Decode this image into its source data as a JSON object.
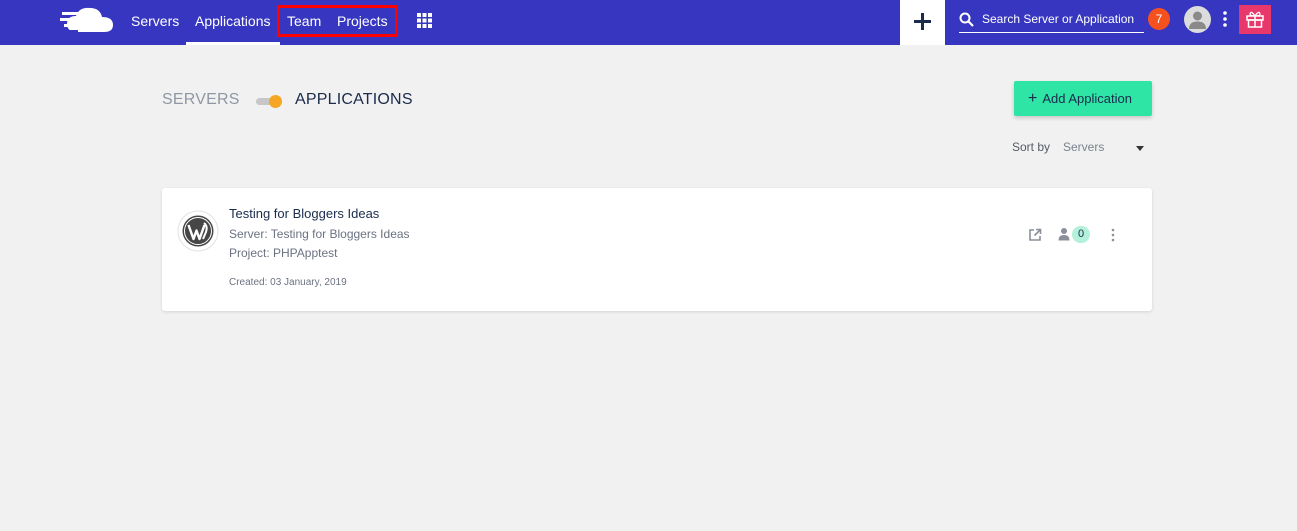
{
  "nav": {
    "logo": "cloudways-logo",
    "items": [
      {
        "label": "Servers"
      },
      {
        "label": "Applications"
      },
      {
        "label": "Team"
      },
      {
        "label": "Projects"
      }
    ],
    "active": "Applications"
  },
  "header": {
    "search_placeholder": "Search Server or Application",
    "notification_count": "7",
    "icons": [
      "grid-icon",
      "plus-icon",
      "search-icon",
      "avatar",
      "kebab-icon",
      "gift-icon"
    ]
  },
  "page": {
    "toggle_left_label": "SERVERS",
    "toggle_right_label": "APPLICATIONS",
    "toggle_state": "applications",
    "add_button_label": "Add Application",
    "sort_label": "Sort by",
    "sort_value": "Servers"
  },
  "applications": [
    {
      "name": "Testing for Bloggers Ideas",
      "server": "Server: Testing for Bloggers Ideas",
      "project": "Project: PHPApptest",
      "created": "Created: 03 January, 2019",
      "icon": "wordpress-icon",
      "members": "0"
    }
  ],
  "colors": {
    "topbar": "#3736c0",
    "accent": "#2ee5a5",
    "notification": "#f4511e",
    "gift": "#e8386b",
    "toggle_knob": "#f5a623",
    "highlight": "#ff0000"
  }
}
